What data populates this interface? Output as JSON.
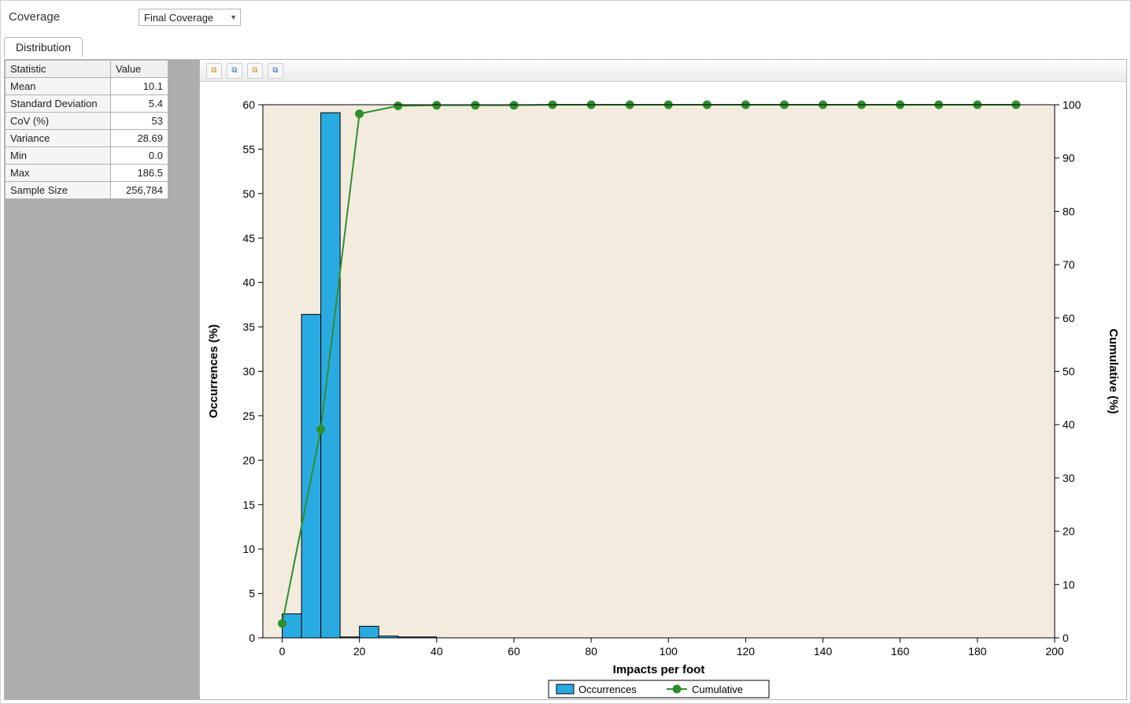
{
  "top": {
    "label": "Coverage",
    "select_value": "Final Coverage"
  },
  "tabs": {
    "distribution": "Distribution"
  },
  "stats": {
    "headers": {
      "stat": "Statistic",
      "val": "Value"
    },
    "rows": [
      {
        "name": "Mean",
        "value": "10.1"
      },
      {
        "name": "Standard Deviation",
        "value": "5.4"
      },
      {
        "name": "CoV (%)",
        "value": "53"
      },
      {
        "name": "Variance",
        "value": "28.69"
      },
      {
        "name": "Min",
        "value": "0.0"
      },
      {
        "name": "Max",
        "value": "186.5"
      },
      {
        "name": "Sample Size",
        "value": "256,784"
      }
    ]
  },
  "toolbar": {
    "btn1": "⧉",
    "btn2": "⧉",
    "btn3": "⧉",
    "btn4": "⧉"
  },
  "chart_data": {
    "type": "histogram+line",
    "xlabel": "Impacts per foot",
    "ylabel_left": "Occurrences (%)",
    "ylabel_right": "Cumulative (%)",
    "x_ticks": [
      0,
      20,
      40,
      60,
      80,
      100,
      120,
      140,
      160,
      180,
      200
    ],
    "y_left_ticks": [
      0,
      5,
      10,
      15,
      20,
      25,
      30,
      35,
      40,
      45,
      50,
      55,
      60
    ],
    "y_right_ticks": [
      0,
      10,
      20,
      30,
      40,
      50,
      60,
      70,
      80,
      90,
      100
    ],
    "xlim": [
      -5,
      200
    ],
    "ylim_left": [
      0,
      60
    ],
    "ylim_right": [
      0,
      100
    ],
    "bars": {
      "bin_width": 5,
      "series": [
        {
          "x_start": 0,
          "occ": 2.7
        },
        {
          "x_start": 5,
          "occ": 36.4
        },
        {
          "x_start": 10,
          "occ": 59.1
        },
        {
          "x_start": 15,
          "occ": 0.1
        },
        {
          "x_start": 20,
          "occ": 1.3
        },
        {
          "x_start": 25,
          "occ": 0.2
        },
        {
          "x_start": 30,
          "occ": 0.1
        },
        {
          "x_start": 35,
          "occ": 0.1
        }
      ]
    },
    "cumulative": {
      "points": [
        {
          "x": 0,
          "c": 2.7
        },
        {
          "x": 10,
          "c": 39.1
        },
        {
          "x": 20,
          "c": 98.3
        },
        {
          "x": 30,
          "c": 99.8
        },
        {
          "x": 40,
          "c": 99.9
        },
        {
          "x": 50,
          "c": 99.9
        },
        {
          "x": 60,
          "c": 99.9
        },
        {
          "x": 70,
          "c": 100
        },
        {
          "x": 80,
          "c": 100
        },
        {
          "x": 90,
          "c": 100
        },
        {
          "x": 100,
          "c": 100
        },
        {
          "x": 110,
          "c": 100
        },
        {
          "x": 120,
          "c": 100
        },
        {
          "x": 130,
          "c": 100
        },
        {
          "x": 140,
          "c": 100
        },
        {
          "x": 150,
          "c": 100
        },
        {
          "x": 160,
          "c": 100
        },
        {
          "x": 170,
          "c": 100
        },
        {
          "x": 180,
          "c": 100
        },
        {
          "x": 190,
          "c": 100
        }
      ]
    },
    "legend": {
      "occ": "Occurrences",
      "cum": "Cumulative"
    }
  }
}
